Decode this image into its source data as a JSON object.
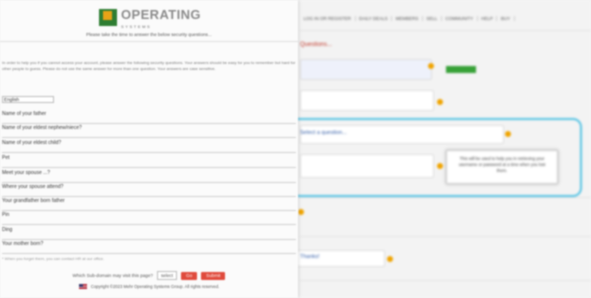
{
  "background": {
    "nav": [
      "LOG IN OR REGISTER",
      "DAILY DEALS",
      "MEMBERS",
      "SELL",
      "COMMUNITY",
      "HELP",
      "BUY"
    ],
    "heading_fragment": "Questions...",
    "badge_text": "",
    "select_placeholder": "Select a question...",
    "tooltip_text": "This will be used to help you in retrieving your username or password at a time when you lost them.",
    "select_answer": "Thanks!",
    "colors": {
      "accent_orange": "#f0a400",
      "highlight_blue": "#57c4e5",
      "green": "#37a137"
    }
  },
  "panel": {
    "logo_text": "OPERATING",
    "logo_sub": "SYSTEMS",
    "tagline": "Please take the time to answer the below security questions...",
    "intro": "In order to help you if you cannot access your account, please answer the following security questions. Your answers should be easy for you to remember but hard for other people to guess. Please do not use the same answer for more than one question. Your answers are case sensitive.",
    "language_select": "English",
    "questions": [
      "Name of your father",
      "Name of your eldest nephew/niece?",
      "Name of your eldest child?",
      "Pet",
      "Meet your spouse ...?",
      "Where your spouse attend?",
      "Your grandfather born father",
      "Pin",
      "Ding",
      "Your mother born?"
    ],
    "hint": "* When you forget them, you can contact HR at our office.",
    "action_prompt": "Which Sub-domain may visit this page?",
    "action_select": "select",
    "action_btn1": "Go",
    "action_btn2": "Submit",
    "footer": "Copyright ©2023 Mehr Operating Systems Group. All rights reserved."
  }
}
